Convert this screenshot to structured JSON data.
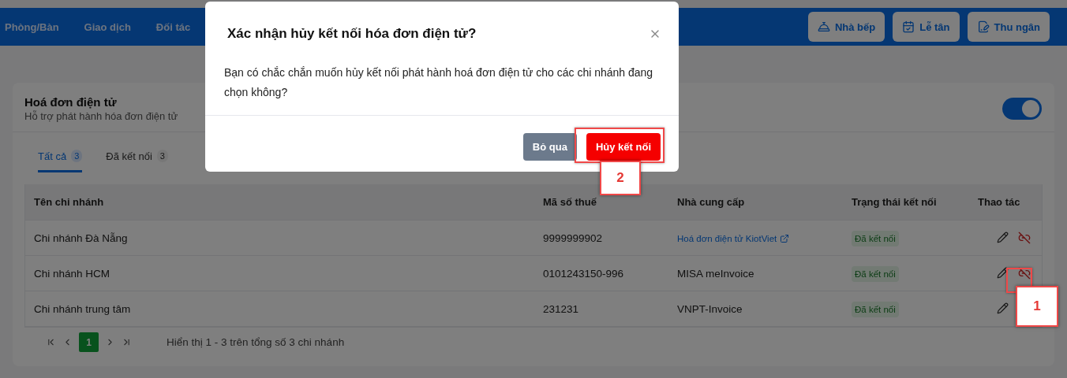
{
  "topbar": {
    "nav": [
      "Phòng/Bàn",
      "Giao dịch",
      "Đối tác"
    ],
    "buttons": [
      {
        "label": "Nhà bếp",
        "kind": "bell"
      },
      {
        "label": "Lễ tân",
        "kind": "calendar"
      },
      {
        "label": "Thu ngân",
        "kind": "file"
      }
    ]
  },
  "card": {
    "title": "Hoá đơn điện tử",
    "subtitle": "Hỗ trợ phát hành hóa đơn điện tử",
    "enabled": true,
    "tabs": [
      {
        "label": "Tất cả",
        "count": "3",
        "selected": true
      },
      {
        "label": "Đã kết nối",
        "count": "3",
        "selected": false
      }
    ],
    "table": {
      "columns": [
        "Tên chi nhánh",
        "Mã số thuế",
        "Nhà cung cấp",
        "Trạng thái kết nối",
        "Thao tác"
      ],
      "rows": [
        {
          "name": "Chi nhánh Đà Nẵng",
          "tax_code": "9999999902",
          "provider": "Hoá đơn điện tử KiotViet",
          "provider_link": true,
          "status": "Đã kết nối"
        },
        {
          "name": "Chi nhánh HCM",
          "tax_code": "0101243150-996",
          "provider": "MISA meInvoice",
          "provider_link": false,
          "status": "Đã kết nối"
        },
        {
          "name": "Chi nhánh trung tâm",
          "tax_code": "231231",
          "provider": "VNPT-Invoice",
          "provider_link": false,
          "status": "Đã kết nối"
        }
      ]
    },
    "pagination": {
      "pages": [
        {
          "label": "1",
          "selected": true
        }
      ],
      "summary": "Hiển thị 1 - 3 trên tổng số 3 chi nhánh"
    }
  },
  "dialog": {
    "title": "Xác nhận hủy kết nối hóa đơn điện tử?",
    "message": "Bạn có chắc chắn muốn hủy kết nối phát hành hoá đơn điện tử cho các chi nhánh đang chọn không?",
    "buttons": [
      {
        "label": "Bỏ qua",
        "kind": "secondary"
      },
      {
        "label": "Hủy kết nối",
        "kind": "danger"
      }
    ]
  },
  "annotations": [
    {
      "label": "1"
    },
    {
      "label": "2"
    }
  ]
}
